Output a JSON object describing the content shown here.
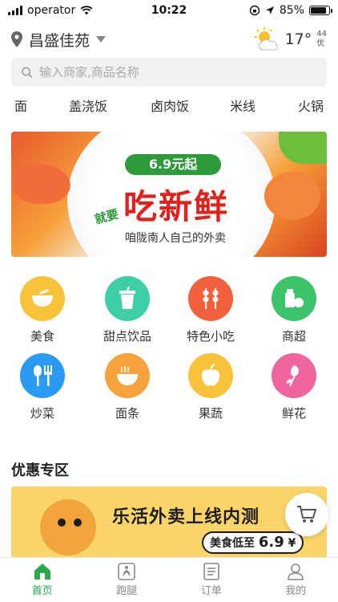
{
  "status_bar": {
    "carrier": "operator",
    "time": "10:22",
    "battery": "85%",
    "battery_level": 0.85
  },
  "header": {
    "location": "昌盛佳苑",
    "temperature": "17°",
    "aqi_value": "44",
    "aqi_label": "优"
  },
  "search": {
    "placeholder": "输入商家,商品名称"
  },
  "category_tabs": [
    "面",
    "盖浇饭",
    "卤肉饭",
    "米线",
    "火锅"
  ],
  "banner": {
    "badge": "6.9元起",
    "prefix": "就要",
    "title": "吃新鲜",
    "subtitle": "咱陇南人自己的外卖"
  },
  "grid": [
    {
      "label": "美食",
      "icon": "bowl-icon",
      "color": "#f8c23a"
    },
    {
      "label": "甜点饮品",
      "icon": "cup-icon",
      "color": "#3fcfa6"
    },
    {
      "label": "特色小吃",
      "icon": "skewer-icon",
      "color": "#f2603d"
    },
    {
      "label": "商超",
      "icon": "grocery-icon",
      "color": "#3dc46b"
    },
    {
      "label": "炒菜",
      "icon": "fork-spoon-icon",
      "color": "#2b9af3"
    },
    {
      "label": "面条",
      "icon": "noodle-bowl-icon",
      "color": "#f7a23a"
    },
    {
      "label": "果蔬",
      "icon": "apple-icon",
      "color": "#f8c23a"
    },
    {
      "label": "鲜花",
      "icon": "flower-icon",
      "color": "#f064a0"
    }
  ],
  "promo": {
    "section_title": "优惠专区",
    "headline": "乐活外卖上线内测",
    "pill_prefix": "美食低至",
    "pill_price": "6.9",
    "pill_unit": "¥"
  },
  "tabbar": [
    {
      "label": "首页",
      "icon": "home-icon",
      "active": true
    },
    {
      "label": "跑腿",
      "icon": "errand-icon",
      "active": false
    },
    {
      "label": "订单",
      "icon": "order-icon",
      "active": false
    },
    {
      "label": "我的",
      "icon": "profile-icon",
      "active": false
    }
  ],
  "colors": {
    "accent": "#2aa84a",
    "banner_red": "#e0211c",
    "promo_yellow": "#fbd56a"
  }
}
